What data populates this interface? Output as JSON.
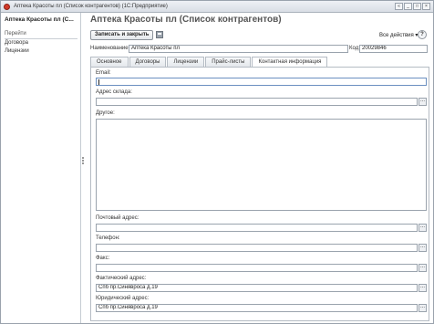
{
  "window": {
    "title": "Аптека Красоты пл (Список контрагентов) (1С:Предприятие)",
    "buttons": [
      "«",
      "_",
      "□",
      "×"
    ]
  },
  "sidebar": {
    "title": "Аптека Красоты пл (С...",
    "goto_label": "Перейти",
    "items": [
      {
        "label": "Договора"
      },
      {
        "label": "Лицензии"
      }
    ]
  },
  "header": {
    "title": "Аптека Красоты пл (Список контрагентов)",
    "save_label": "Записать и закрыть",
    "all_actions_label": "Все действия ▾",
    "help_label": "?"
  },
  "form": {
    "name_label": "Наименование:",
    "name_value": "Аптека Красоты пл",
    "code_label": "Код:",
    "code_value": "20029846"
  },
  "tabs": [
    {
      "label": "Основное"
    },
    {
      "label": "Договоры"
    },
    {
      "label": "Лицензии"
    },
    {
      "label": "Прайс-листы"
    },
    {
      "label": "Контактная информация",
      "active": true
    }
  ],
  "contact": {
    "email_label": "Email:",
    "email_value": "",
    "warehouse_label": "Адрес склада:",
    "warehouse_value": "",
    "other_label": "Другое:",
    "postal_label": "Почтовый адрес:",
    "postal_value": "",
    "phone_label": "Телефон:",
    "phone_value": "",
    "fax_label": "Факс:",
    "fax_value": "",
    "actual_label": "Фактический адрес:",
    "actual_value": "Спб пр.Синявроса д.19",
    "legal_label": "Юридический адрес:",
    "legal_value": "Спб пр.Синявроса д.19",
    "select_button": "..."
  }
}
